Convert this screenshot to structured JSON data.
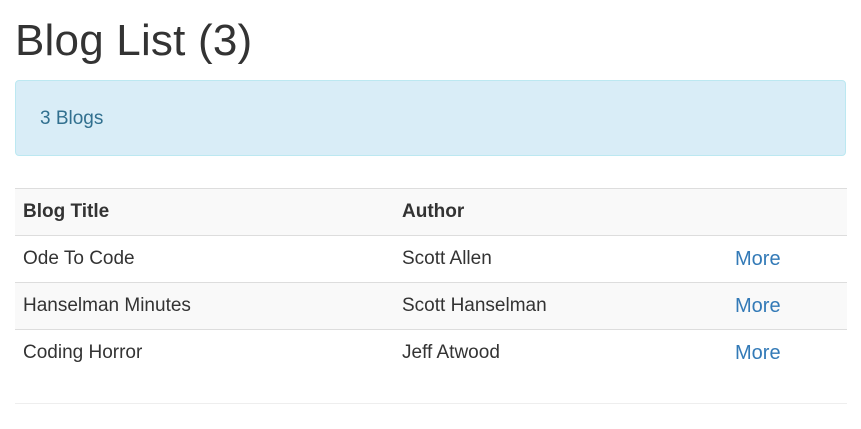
{
  "page": {
    "title": "Blog List (3)"
  },
  "alert": {
    "text": "3 Blogs"
  },
  "table": {
    "headers": [
      "Blog Title",
      "Author",
      ""
    ],
    "rows": [
      {
        "title": "Ode To Code",
        "author": "Scott Allen",
        "link": "More"
      },
      {
        "title": "Hanselman Minutes",
        "author": "Scott Hanselman",
        "link": "More"
      },
      {
        "title": "Coding Horror",
        "author": "Jeff Atwood",
        "link": "More"
      }
    ]
  },
  "colors": {
    "alert_bg": "#d9edf7",
    "alert_border": "#bce8f1",
    "alert_text": "#31708f",
    "link": "#337ab7",
    "stripe": "#f9f9f9"
  }
}
